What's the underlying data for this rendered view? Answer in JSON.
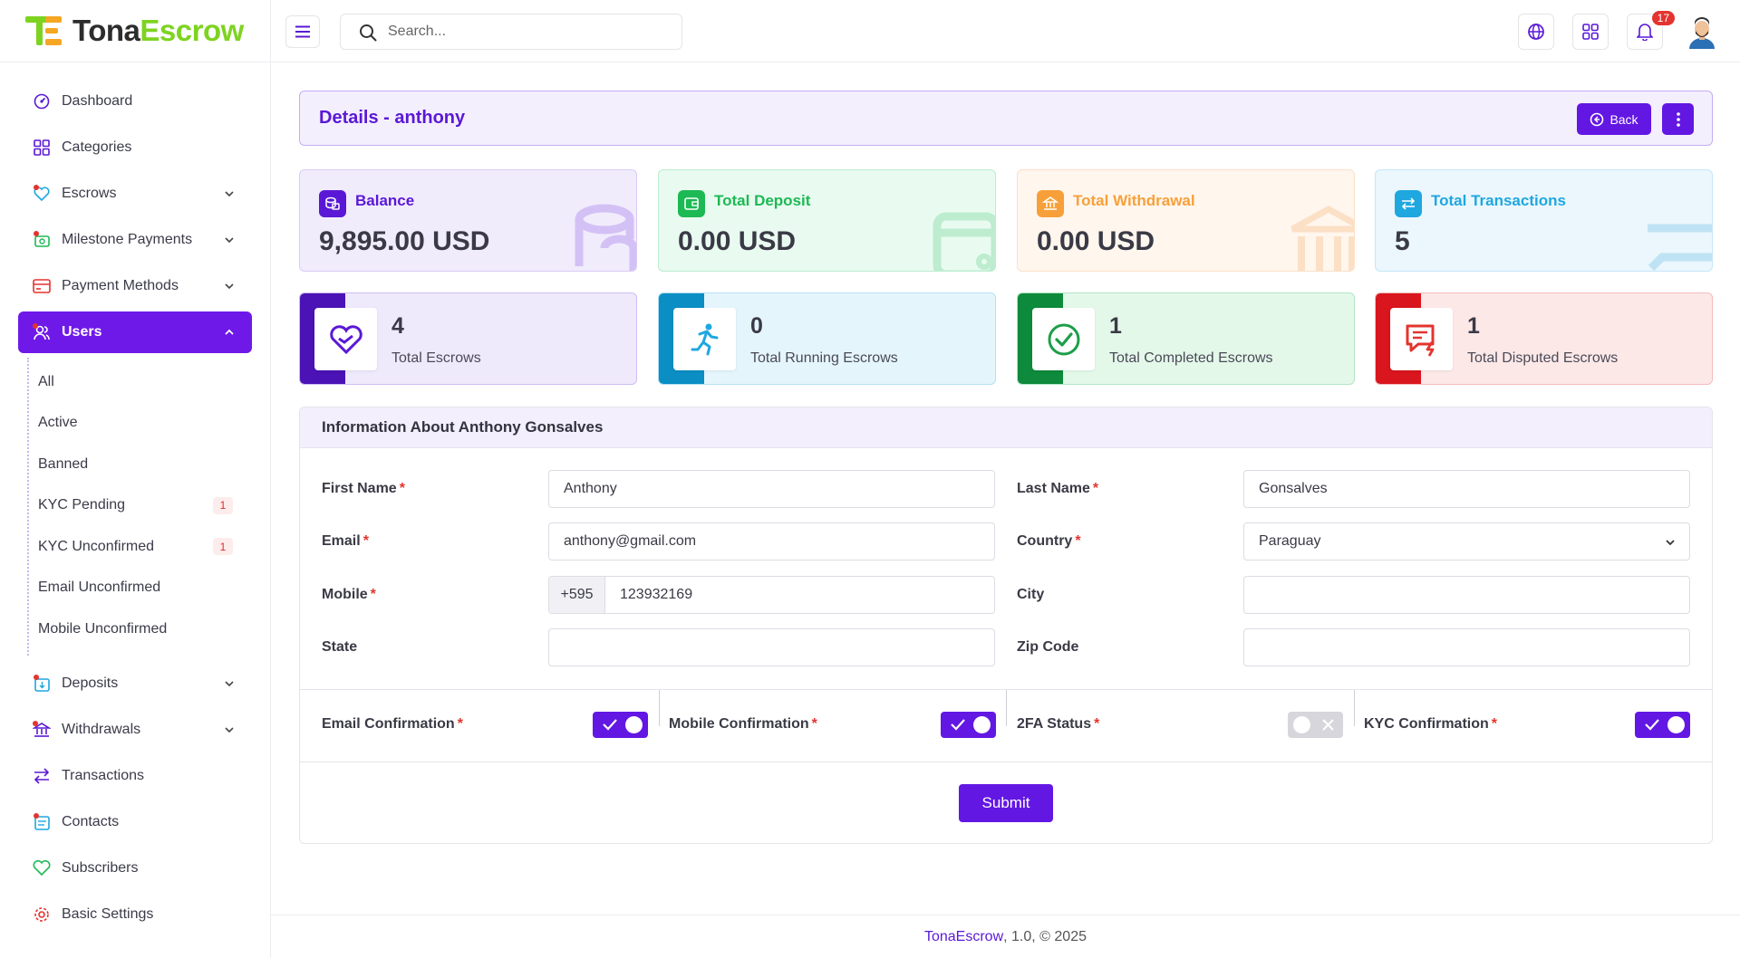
{
  "brand": {
    "part1": "Tona",
    "part2": "Escrow"
  },
  "search": {
    "placeholder": "Search..."
  },
  "topbar": {
    "notif_count": "17"
  },
  "sidebar": {
    "items": [
      {
        "label": "Dashboard"
      },
      {
        "label": "Categories"
      },
      {
        "label": "Escrows"
      },
      {
        "label": "Milestone Payments"
      },
      {
        "label": "Payment Methods"
      },
      {
        "label": "Users"
      },
      {
        "label": "Deposits"
      },
      {
        "label": "Withdrawals"
      },
      {
        "label": "Transactions"
      },
      {
        "label": "Contacts"
      },
      {
        "label": "Subscribers"
      },
      {
        "label": "Basic Settings"
      }
    ],
    "users_sub": [
      {
        "label": "All"
      },
      {
        "label": "Active"
      },
      {
        "label": "Banned"
      },
      {
        "label": "KYC Pending",
        "badge": "1"
      },
      {
        "label": "KYC Unconfirmed",
        "badge": "1"
      },
      {
        "label": "Email Unconfirmed"
      },
      {
        "label": "Mobile Unconfirmed"
      }
    ]
  },
  "header": {
    "title": "Details - anthony",
    "back_label": "Back"
  },
  "stats": [
    {
      "label": "Balance",
      "value": "9,895.00 USD",
      "color": "#5a18d6"
    },
    {
      "label": "Total Deposit",
      "value": "0.00 USD",
      "color": "#1db954"
    },
    {
      "label": "Total Withdrawal",
      "value": "0.00 USD",
      "color": "#f7a03a"
    },
    {
      "label": "Total Transactions",
      "value": "5",
      "color": "#1fa7e0"
    }
  ],
  "escrow_cards": [
    {
      "count": "4",
      "label": "Total Escrows"
    },
    {
      "count": "0",
      "label": "Total Running Escrows"
    },
    {
      "count": "1",
      "label": "Total Completed Escrows"
    },
    {
      "count": "1",
      "label": "Total Disputed Escrows"
    }
  ],
  "info": {
    "title": "Information About Anthony Gonsalves",
    "first_name_label": "First Name",
    "first_name": "Anthony",
    "last_name_label": "Last Name",
    "last_name": "Gonsalves",
    "email_label": "Email",
    "email": "anthony@gmail.com",
    "country_label": "Country",
    "country": "Paraguay",
    "mobile_label": "Mobile",
    "mobile_prefix": "+595",
    "mobile": "123932169",
    "city_label": "City",
    "city": "",
    "state_label": "State",
    "state": "",
    "zip_label": "Zip Code",
    "zip": "",
    "email_conf_label": "Email Confirmation",
    "mobile_conf_label": "Mobile Confirmation",
    "twofa_label": "2FA Status",
    "kyc_conf_label": "KYC Confirmation",
    "email_conf_on": true,
    "mobile_conf_on": true,
    "twofa_on": false,
    "kyc_conf_on": true,
    "submit_label": "Submit"
  },
  "footer": {
    "brand": "TonaEscrow",
    "rest": ", 1.0, © 2025"
  }
}
